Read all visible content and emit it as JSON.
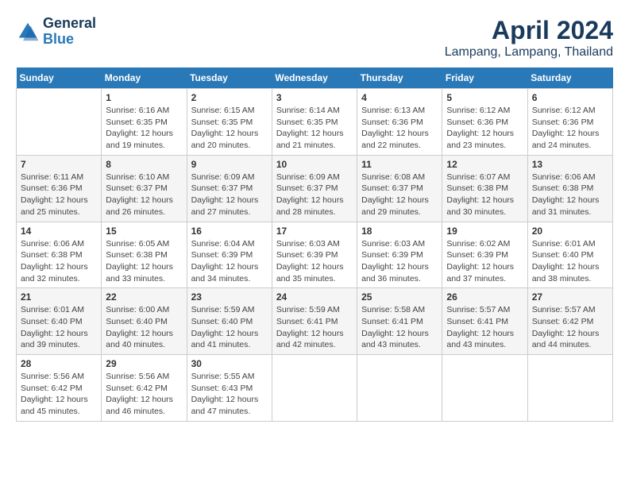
{
  "logo": {
    "line1": "General",
    "line2": "Blue"
  },
  "title": "April 2024",
  "subtitle": "Lampang, Lampang, Thailand",
  "days_of_week": [
    "Sunday",
    "Monday",
    "Tuesday",
    "Wednesday",
    "Thursday",
    "Friday",
    "Saturday"
  ],
  "weeks": [
    [
      {
        "day": "",
        "info": ""
      },
      {
        "day": "1",
        "info": "Sunrise: 6:16 AM\nSunset: 6:35 PM\nDaylight: 12 hours\nand 19 minutes."
      },
      {
        "day": "2",
        "info": "Sunrise: 6:15 AM\nSunset: 6:35 PM\nDaylight: 12 hours\nand 20 minutes."
      },
      {
        "day": "3",
        "info": "Sunrise: 6:14 AM\nSunset: 6:35 PM\nDaylight: 12 hours\nand 21 minutes."
      },
      {
        "day": "4",
        "info": "Sunrise: 6:13 AM\nSunset: 6:36 PM\nDaylight: 12 hours\nand 22 minutes."
      },
      {
        "day": "5",
        "info": "Sunrise: 6:12 AM\nSunset: 6:36 PM\nDaylight: 12 hours\nand 23 minutes."
      },
      {
        "day": "6",
        "info": "Sunrise: 6:12 AM\nSunset: 6:36 PM\nDaylight: 12 hours\nand 24 minutes."
      }
    ],
    [
      {
        "day": "7",
        "info": "Sunrise: 6:11 AM\nSunset: 6:36 PM\nDaylight: 12 hours\nand 25 minutes."
      },
      {
        "day": "8",
        "info": "Sunrise: 6:10 AM\nSunset: 6:37 PM\nDaylight: 12 hours\nand 26 minutes."
      },
      {
        "day": "9",
        "info": "Sunrise: 6:09 AM\nSunset: 6:37 PM\nDaylight: 12 hours\nand 27 minutes."
      },
      {
        "day": "10",
        "info": "Sunrise: 6:09 AM\nSunset: 6:37 PM\nDaylight: 12 hours\nand 28 minutes."
      },
      {
        "day": "11",
        "info": "Sunrise: 6:08 AM\nSunset: 6:37 PM\nDaylight: 12 hours\nand 29 minutes."
      },
      {
        "day": "12",
        "info": "Sunrise: 6:07 AM\nSunset: 6:38 PM\nDaylight: 12 hours\nand 30 minutes."
      },
      {
        "day": "13",
        "info": "Sunrise: 6:06 AM\nSunset: 6:38 PM\nDaylight: 12 hours\nand 31 minutes."
      }
    ],
    [
      {
        "day": "14",
        "info": "Sunrise: 6:06 AM\nSunset: 6:38 PM\nDaylight: 12 hours\nand 32 minutes."
      },
      {
        "day": "15",
        "info": "Sunrise: 6:05 AM\nSunset: 6:38 PM\nDaylight: 12 hours\nand 33 minutes."
      },
      {
        "day": "16",
        "info": "Sunrise: 6:04 AM\nSunset: 6:39 PM\nDaylight: 12 hours\nand 34 minutes."
      },
      {
        "day": "17",
        "info": "Sunrise: 6:03 AM\nSunset: 6:39 PM\nDaylight: 12 hours\nand 35 minutes."
      },
      {
        "day": "18",
        "info": "Sunrise: 6:03 AM\nSunset: 6:39 PM\nDaylight: 12 hours\nand 36 minutes."
      },
      {
        "day": "19",
        "info": "Sunrise: 6:02 AM\nSunset: 6:39 PM\nDaylight: 12 hours\nand 37 minutes."
      },
      {
        "day": "20",
        "info": "Sunrise: 6:01 AM\nSunset: 6:40 PM\nDaylight: 12 hours\nand 38 minutes."
      }
    ],
    [
      {
        "day": "21",
        "info": "Sunrise: 6:01 AM\nSunset: 6:40 PM\nDaylight: 12 hours\nand 39 minutes."
      },
      {
        "day": "22",
        "info": "Sunrise: 6:00 AM\nSunset: 6:40 PM\nDaylight: 12 hours\nand 40 minutes."
      },
      {
        "day": "23",
        "info": "Sunrise: 5:59 AM\nSunset: 6:40 PM\nDaylight: 12 hours\nand 41 minutes."
      },
      {
        "day": "24",
        "info": "Sunrise: 5:59 AM\nSunset: 6:41 PM\nDaylight: 12 hours\nand 42 minutes."
      },
      {
        "day": "25",
        "info": "Sunrise: 5:58 AM\nSunset: 6:41 PM\nDaylight: 12 hours\nand 43 minutes."
      },
      {
        "day": "26",
        "info": "Sunrise: 5:57 AM\nSunset: 6:41 PM\nDaylight: 12 hours\nand 43 minutes."
      },
      {
        "day": "27",
        "info": "Sunrise: 5:57 AM\nSunset: 6:42 PM\nDaylight: 12 hours\nand 44 minutes."
      }
    ],
    [
      {
        "day": "28",
        "info": "Sunrise: 5:56 AM\nSunset: 6:42 PM\nDaylight: 12 hours\nand 45 minutes."
      },
      {
        "day": "29",
        "info": "Sunrise: 5:56 AM\nSunset: 6:42 PM\nDaylight: 12 hours\nand 46 minutes."
      },
      {
        "day": "30",
        "info": "Sunrise: 5:55 AM\nSunset: 6:43 PM\nDaylight: 12 hours\nand 47 minutes."
      },
      {
        "day": "",
        "info": ""
      },
      {
        "day": "",
        "info": ""
      },
      {
        "day": "",
        "info": ""
      },
      {
        "day": "",
        "info": ""
      }
    ]
  ]
}
